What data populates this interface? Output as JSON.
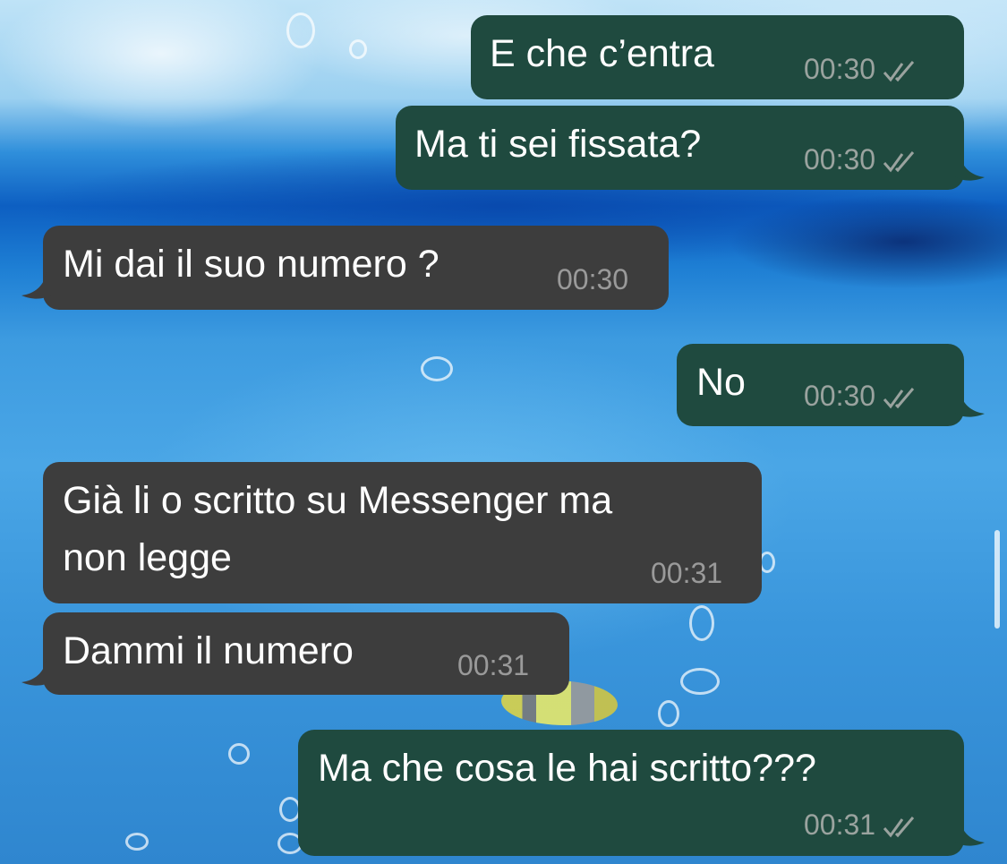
{
  "chat": {
    "messages": [
      {
        "direction": "outgoing",
        "text": "E che c’entra",
        "time": "00:30",
        "status": "read-double-check"
      },
      {
        "direction": "outgoing",
        "text": "Ma ti sei fissata?",
        "time": "00:30",
        "status": "read-double-check"
      },
      {
        "direction": "incoming",
        "text": "Mi dai il suo numero ?",
        "time": "00:30"
      },
      {
        "direction": "outgoing",
        "text": "No",
        "time": "00:30",
        "status": "read-double-check"
      },
      {
        "direction": "incoming",
        "text_line1": "Già li o scritto su Messenger ma",
        "text_line2": "non legge",
        "time": "00:31"
      },
      {
        "direction": "incoming",
        "text": "Dammi il numero",
        "time": "00:31"
      },
      {
        "direction": "outgoing",
        "text": "Ma che cosa le hai scritto???",
        "time": "00:31",
        "status": "read-double-check"
      }
    ]
  },
  "colors": {
    "outgoing_bubble": "#1f4a3f",
    "incoming_bubble": "#3d3d3d",
    "timestamp": "#9aa39f"
  },
  "icons": {
    "status": "double-check-icon",
    "background": "underwater-wallpaper"
  }
}
